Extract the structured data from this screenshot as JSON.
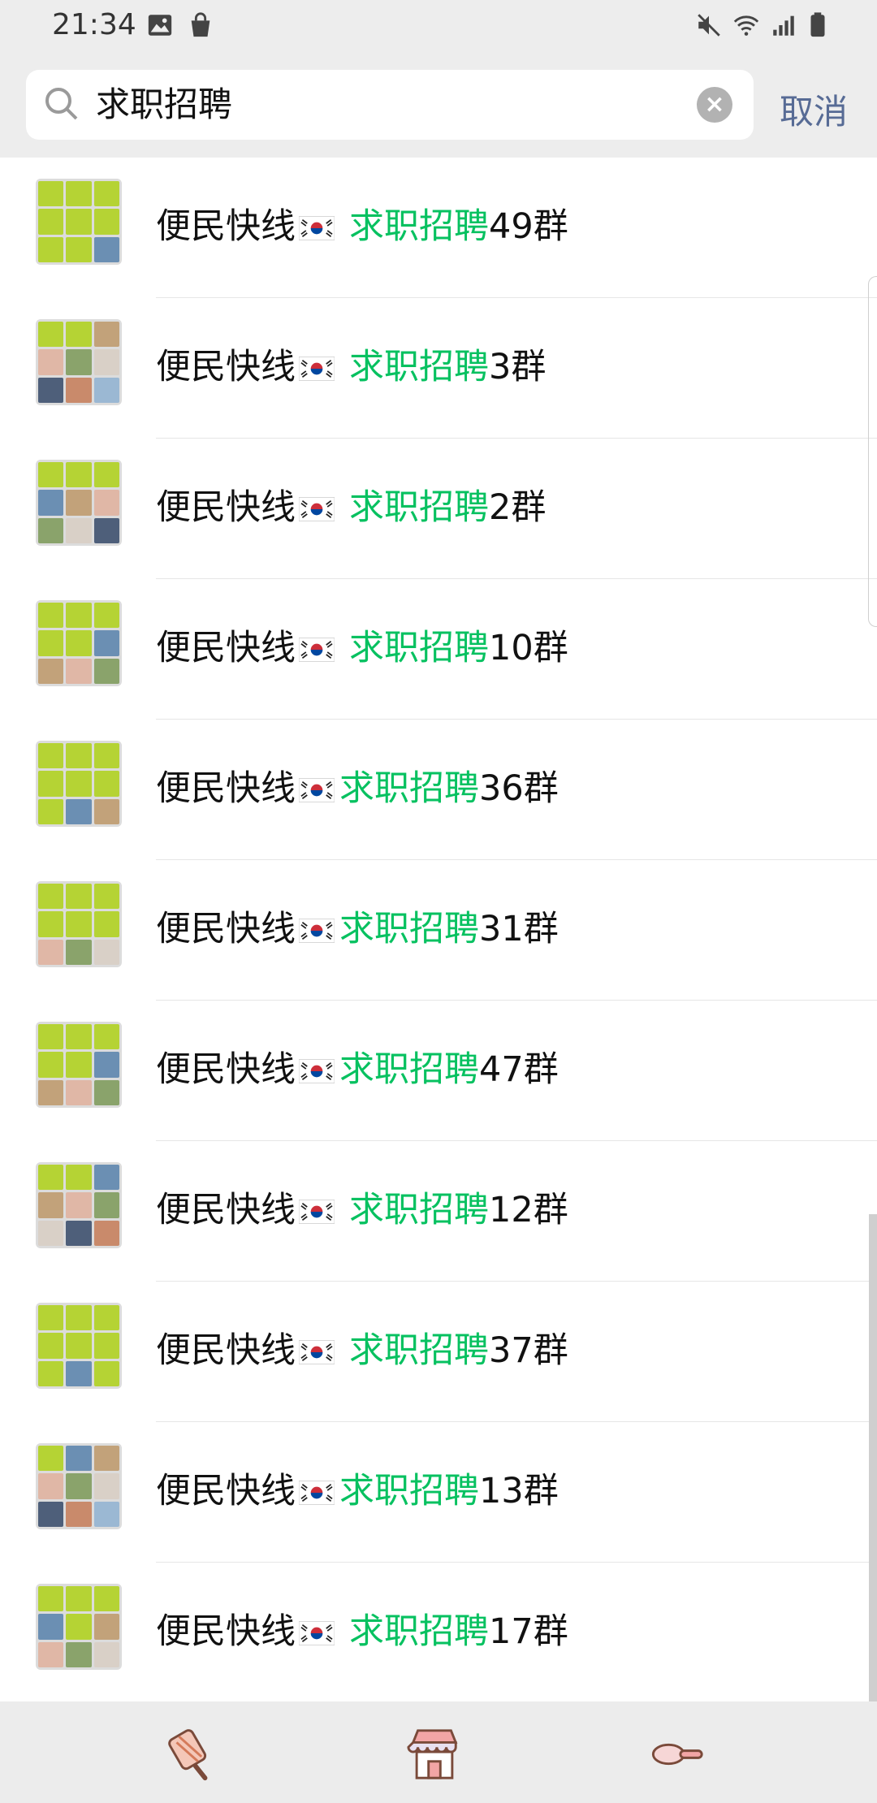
{
  "status_bar": {
    "time": "21:34",
    "icons": [
      "image-icon",
      "bag-icon",
      "mute-icon",
      "wifi-icon",
      "signal-icon",
      "battery-icon"
    ]
  },
  "search": {
    "query": "求职招聘",
    "cancel_label": "取消"
  },
  "results": [
    {
      "prefix": "便民快线",
      "flag": "korea-flag-icon",
      "keyword": "求职招聘",
      "suffix": "49群"
    },
    {
      "prefix": "便民快线",
      "flag": "korea-flag-icon",
      "keyword": "求职招聘",
      "suffix": "3群"
    },
    {
      "prefix": "便民快线",
      "flag": "korea-flag-icon",
      "keyword": "求职招聘",
      "suffix": "2群"
    },
    {
      "prefix": "便民快线",
      "flag": "korea-flag-icon",
      "keyword": "求职招聘",
      "suffix": "10群"
    },
    {
      "prefix": "便民快线",
      "flag": "korea-flag-icon",
      "keyword": "求职招聘",
      "suffix": "36群"
    },
    {
      "prefix": "便民快线",
      "flag": "korea-flag-icon",
      "keyword": "求职招聘",
      "suffix": "31群"
    },
    {
      "prefix": "便民快线",
      "flag": "korea-flag-icon",
      "keyword": "求职招聘",
      "suffix": "47群"
    },
    {
      "prefix": "便民快线",
      "flag": "korea-flag-icon",
      "keyword": "求职招聘",
      "suffix": "12群"
    },
    {
      "prefix": "便民快线",
      "flag": "korea-flag-icon",
      "keyword": "求职招聘",
      "suffix": "37群"
    },
    {
      "prefix": "便民快线",
      "flag": "korea-flag-icon",
      "keyword": "求职招聘",
      "suffix": "13群"
    },
    {
      "prefix": "便民快线",
      "flag": "korea-flag-icon",
      "keyword": "求职招聘",
      "suffix": "17群"
    }
  ],
  "bottom_bar": {
    "icons": [
      "ice-cream-icon",
      "store-icon",
      "spoon-icon"
    ]
  },
  "colors": {
    "highlight": "#07c160",
    "cancel": "#576b95",
    "header_bg": "#ededed",
    "avatar_green": "#b5d334"
  }
}
